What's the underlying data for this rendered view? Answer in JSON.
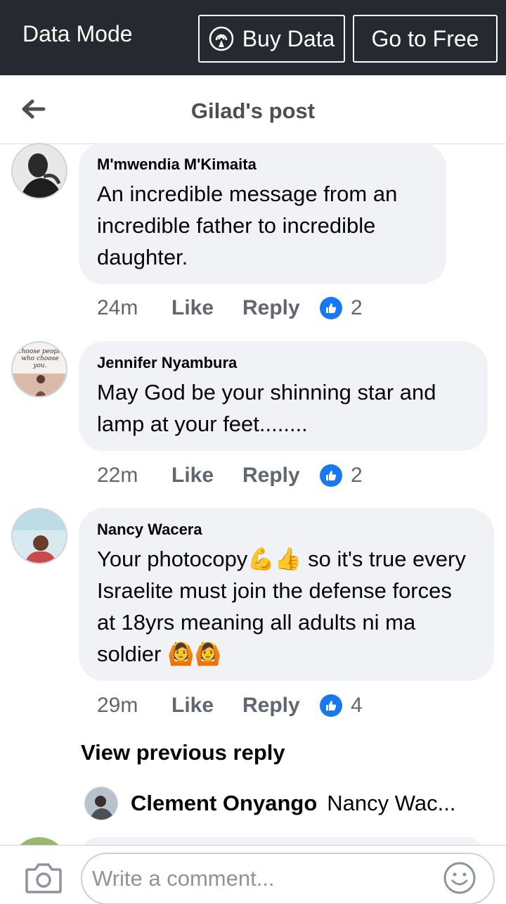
{
  "topbar": {
    "mode_label": "Data Mode",
    "buy_label": "Buy Data",
    "free_label": "Go to Free",
    "background": "#262a30"
  },
  "header": {
    "title": "Gilad's post"
  },
  "comments": [
    {
      "author": "M'mwendia M'Kimaita",
      "text": "An incredible message from an incredible father to incredible daughter.",
      "time": "24m",
      "like_label": "Like",
      "reply_label": "Reply",
      "reaction_count": "2",
      "avatar_icon": "man-portrait-avatar"
    },
    {
      "author": "Jennifer Nyambura",
      "text": "May God be your shinning star and lamp at your feet........",
      "time": "22m",
      "like_label": "Like",
      "reply_label": "Reply",
      "reaction_count": "2",
      "avatar_text": "Choose people who choose you."
    },
    {
      "author": "Nancy Wacera",
      "text_parts": [
        "Your photocopy",
        " so it's true every Israelite  must join the defense forces at 18yrs meaning all adults ni ma soldier "
      ],
      "emojis": [
        "💪",
        "👍",
        "🙆",
        "🙆"
      ],
      "time": "29m",
      "like_label": "Like",
      "reply_label": "Reply",
      "reaction_count": "4",
      "avatar_icon": "woman-photo-avatar"
    }
  ],
  "view_previous": "View previous reply",
  "reply_preview": {
    "author": "Clement Onyango",
    "preview": "Nancy Wac..."
  },
  "composer": {
    "placeholder": "Write a comment..."
  },
  "colors": {
    "accent": "#1877f2",
    "bubble": "#f0f2f5",
    "meta_text": "#606770"
  }
}
